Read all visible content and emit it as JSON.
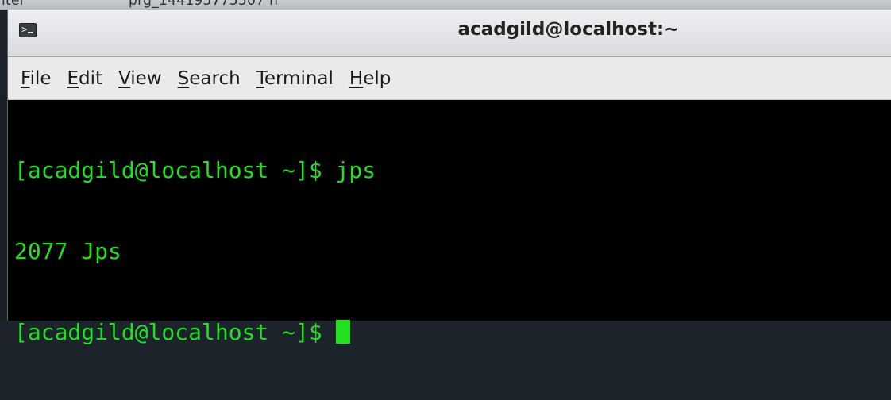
{
  "background": {
    "fragment_left": "iter",
    "fragment_mid": "prg_144195775507 n"
  },
  "window": {
    "title": "acadgild@localhost:~",
    "icon": "terminal-icon"
  },
  "menubar": {
    "items": [
      {
        "mnemonic": "F",
        "rest": "ile"
      },
      {
        "mnemonic": "E",
        "rest": "dit"
      },
      {
        "mnemonic": "V",
        "rest": "iew"
      },
      {
        "mnemonic": "S",
        "rest": "earch"
      },
      {
        "mnemonic": "T",
        "rest": "erminal"
      },
      {
        "mnemonic": "H",
        "rest": "elp"
      }
    ]
  },
  "terminal": {
    "lines": [
      "[acadgild@localhost ~]$ jps",
      "2077 Jps",
      "[acadgild@localhost ~]$ "
    ],
    "text_color": "#20e020",
    "background_color": "#000000"
  }
}
